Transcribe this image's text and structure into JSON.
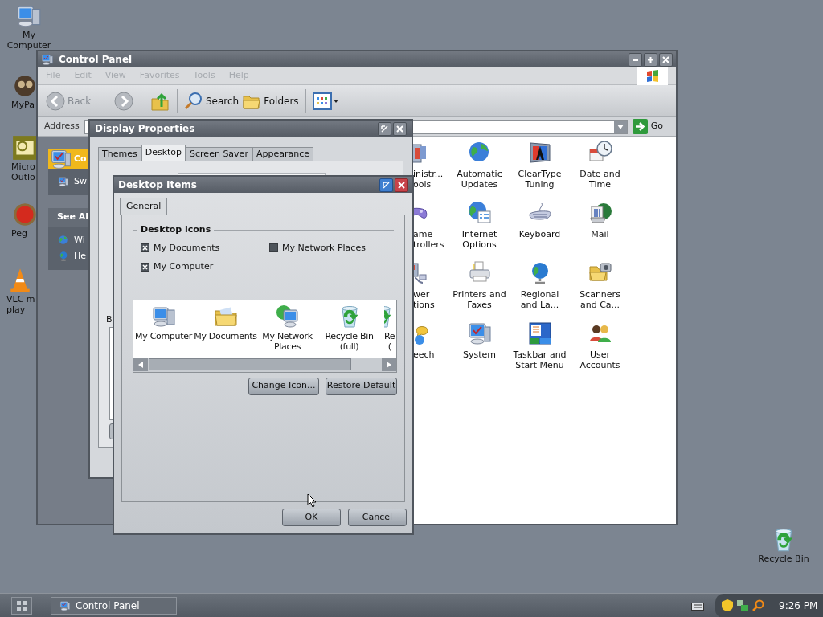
{
  "desktop_icons": [
    {
      "lines": [
        "My",
        "Computer"
      ]
    },
    {
      "lines": [
        "MyPa"
      ]
    },
    {
      "lines": [
        "Micro",
        "Outlo"
      ]
    },
    {
      "lines": [
        "Peg"
      ]
    },
    {
      "lines": [
        "VLC m",
        "play"
      ]
    },
    {
      "lines": [
        "Recycle Bin"
      ]
    }
  ],
  "control_panel": {
    "title": "Control Panel",
    "menu": [
      {
        "label": "File",
        "disabled": true
      },
      {
        "label": "Edit",
        "disabled": true
      },
      {
        "label": "View",
        "disabled": true
      },
      {
        "label": "Favorites",
        "disabled": true
      },
      {
        "label": "Tools",
        "disabled": true
      },
      {
        "label": "Help",
        "disabled": true
      }
    ],
    "toolbar": [
      {
        "kind": "back",
        "label": "Back",
        "disabled": true
      },
      {
        "kind": "forward",
        "disabled": true
      },
      {
        "kind": "up",
        "disabled": false
      },
      {
        "kind": "search",
        "label": "Search",
        "disabled": false
      },
      {
        "kind": "folders",
        "label": "Folders",
        "disabled": false
      },
      {
        "kind": "views"
      }
    ],
    "address": {
      "label": "Address",
      "go": "Go"
    },
    "sidebar": [
      {
        "title": "Co",
        "items": [
          "Sw"
        ]
      },
      {
        "title": "See Al",
        "items": [
          "Wi",
          "He"
        ]
      }
    ],
    "items": [
      {
        "lines": [
          "inistr...",
          "ools"
        ]
      },
      {
        "lines": [
          "Automatic",
          "Updates"
        ]
      },
      {
        "lines": [
          "ClearType",
          "Tuning"
        ]
      },
      {
        "lines": [
          "Date and",
          "Time"
        ]
      },
      {
        "lines": [
          "ame",
          "trollers"
        ]
      },
      {
        "lines": [
          "Internet",
          "Options"
        ]
      },
      {
        "lines": [
          "Keyboard"
        ]
      },
      {
        "lines": [
          "Mail"
        ]
      },
      {
        "lines": [
          "wer",
          "tions"
        ]
      },
      {
        "lines": [
          "Printers and",
          "Faxes"
        ]
      },
      {
        "lines": [
          "Regional",
          "and La..."
        ]
      },
      {
        "lines": [
          "Scanners",
          "and Ca..."
        ]
      },
      {
        "lines": [
          "eech"
        ]
      },
      {
        "lines": [
          "System"
        ]
      },
      {
        "lines": [
          "Taskbar and",
          "Start Menu"
        ]
      },
      {
        "lines": [
          "User",
          "Accounts"
        ]
      }
    ]
  },
  "display_properties": {
    "title": "Display Properties",
    "tabs": [
      {
        "label": "Themes",
        "selected": false
      },
      {
        "label": "Desktop",
        "selected": true
      },
      {
        "label": "Screen Saver",
        "selected": false
      },
      {
        "label": "Appearance",
        "selected": false
      }
    ],
    "background_label": "B"
  },
  "desktop_items": {
    "title": "Desktop Items",
    "tabs": [
      {
        "label": "General",
        "selected": true
      }
    ],
    "group": "Desktop icons",
    "checkboxes": [
      {
        "label": "My Documents",
        "checked": true
      },
      {
        "label": "My Network Places",
        "checked": false
      },
      {
        "label": "My Computer",
        "checked": true
      }
    ],
    "list_items": [
      {
        "lines": [
          "My Computer"
        ]
      },
      {
        "lines": [
          "My Documents"
        ]
      },
      {
        "lines": [
          "My Network",
          "Places"
        ]
      },
      {
        "lines": [
          "Recycle Bin",
          "(full)"
        ]
      },
      {
        "lines": [
          "Re",
          "("
        ]
      }
    ],
    "buttons": [
      "Change Icon...",
      "Restore Default"
    ],
    "footer_buttons": [
      "OK",
      "Cancel"
    ]
  },
  "taskbar": {
    "tasks": [
      {
        "label": "Control Panel"
      }
    ],
    "clock": "9:26 PM"
  }
}
